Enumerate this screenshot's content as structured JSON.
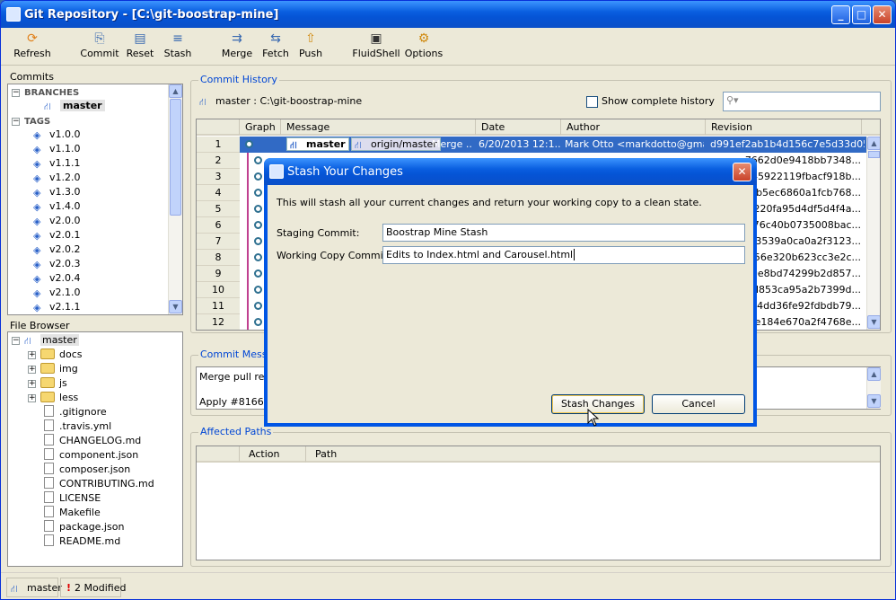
{
  "window": {
    "title": "Git Repository - [C:\\git-boostrap-mine]"
  },
  "toolbar": [
    {
      "label": "Refresh",
      "icon": "refresh-icon"
    },
    {
      "label": "Commit",
      "icon": "commit-icon"
    },
    {
      "label": "Reset",
      "icon": "reset-icon"
    },
    {
      "label": "Stash",
      "icon": "stash-icon"
    },
    {
      "label": "Merge",
      "icon": "merge-icon"
    },
    {
      "label": "Fetch",
      "icon": "fetch-icon"
    },
    {
      "label": "Push",
      "icon": "push-icon"
    },
    {
      "label": "FluidShell",
      "icon": "shell-icon"
    },
    {
      "label": "Options",
      "icon": "gear-icon"
    }
  ],
  "commits_panel": {
    "title": "Commits",
    "branches_label": "BRANCHES",
    "branch": "master",
    "tags_label": "TAGS",
    "tags": [
      "v1.0.0",
      "v1.1.0",
      "v1.1.1",
      "v1.2.0",
      "v1.3.0",
      "v1.4.0",
      "v2.0.0",
      "v2.0.1",
      "v2.0.2",
      "v2.0.3",
      "v2.0.4",
      "v2.1.0",
      "v2.1.1"
    ]
  },
  "file_browser": {
    "title": "File Browser",
    "root": "master",
    "folders": [
      "docs",
      "img",
      "js",
      "less"
    ],
    "files": [
      ".gitignore",
      ".travis.yml",
      "CHANGELOG.md",
      "component.json",
      "composer.json",
      "CONTRIBUTING.md",
      "LICENSE",
      "Makefile",
      "package.json",
      "README.md"
    ]
  },
  "commit_history": {
    "title": "Commit History",
    "branch_path": "master : C:\\git-boostrap-mine",
    "show_complete_label": "Show complete history",
    "search_placeholder": "",
    "columns": [
      "Graph",
      "Message",
      "Date",
      "Author",
      "Revision"
    ],
    "row_numbers": [
      "1",
      "2",
      "3",
      "4",
      "5",
      "6",
      "7",
      "8",
      "9",
      "10",
      "11",
      "12"
    ],
    "first_row": {
      "branch_badge": "master",
      "remote_badge": "origin/master",
      "message": "Merge ...",
      "date": "6/20/2013 12:1...",
      "author": "Mark Otto <markdotto@gmai...",
      "revision": "d991ef2ab1b4d156c7e5d33d05..."
    },
    "revisions": [
      "7662d0e9418bb7348...",
      "45922119fbacf918b...",
      "3b5ec6860a1fcb768...",
      "220fa95d4df5d4f4a...",
      "876c40b0735008bac...",
      "53539a0ca0a2f3123...",
      "656e320b623cc3e2c...",
      "9e8bd74299b2d857...",
      "7d853ca95a2b7399d...",
      "d4dd36fe92fdbdb79...",
      "7e184e670a2f4768e..."
    ]
  },
  "commit_message": {
    "title": "Commit Message",
    "line1": "Merge pull requ",
    "line2": "Apply #8166 to"
  },
  "affected_paths": {
    "title": "Affected Paths",
    "columns": [
      "Action",
      "Path"
    ]
  },
  "dialog": {
    "title": "Stash Your Changes",
    "description": "This will stash all your current changes and return your working copy to a clean state.",
    "staging_label": "Staging Commit:",
    "staging_value": "Boostrap Mine Stash",
    "working_label": "Working Copy Commit:",
    "working_value": "Edits to Index.html and Carousel.html",
    "stash_button": "Stash Changes",
    "cancel_button": "Cancel"
  },
  "status_bar": {
    "branch": "master",
    "modified": "2 Modified"
  }
}
